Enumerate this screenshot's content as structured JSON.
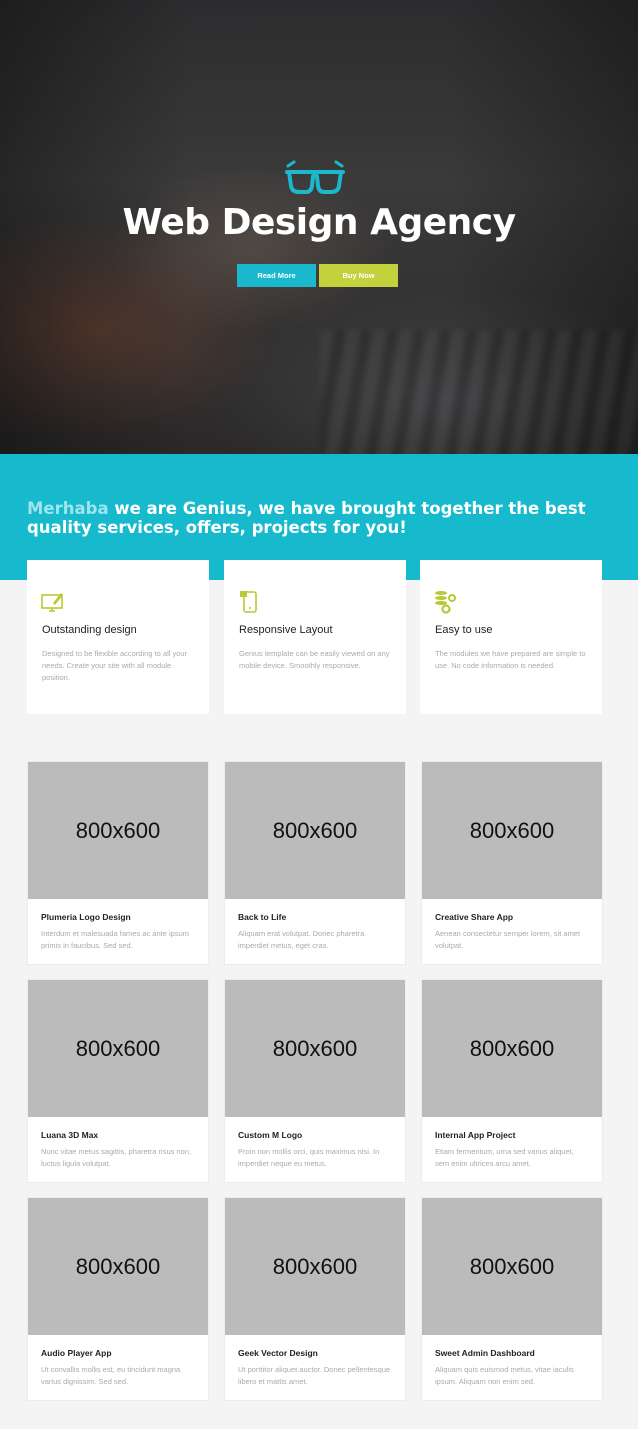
{
  "hero": {
    "icon": "glasses-icon",
    "title": "Web Design Agency",
    "read_more": "Read More",
    "buy_now": "Buy Now"
  },
  "intro": {
    "highlight": "Merhaba",
    "text": " we are Genius, we have brought together the best quality services, offers, projects for you!"
  },
  "features": [
    {
      "icon": "monitor-pen-icon",
      "title": "Outstanding design",
      "desc": "Designed to be flexible according to all your needs. Create your site with all module position."
    },
    {
      "icon": "mobile-icon",
      "title": "Responsive Layout",
      "desc": "Genius template can be easily viewed on any mobile device. Smoothly responsive."
    },
    {
      "icon": "database-gear-icon",
      "title": "Easy to use",
      "desc": "The modules we have prepared are simple to use. No code information is needed."
    }
  ],
  "portfolio": [
    {
      "image": "800x600",
      "title": "Plumeria Logo Design",
      "desc": "Interdum et malesuada fames ac ante ipsum primis in faucibus. Sed sed."
    },
    {
      "image": "800x600",
      "title": "Back to Life",
      "desc": "Aliquam erat volutpat. Donec pharetra imperdiet metus, eget cras."
    },
    {
      "image": "800x600",
      "title": "Creative Share App",
      "desc": "Aenean consectetur semper lorem, sit amet volutpat."
    },
    {
      "image": "800x600",
      "title": "Luana 3D Max",
      "desc": "Nunc vitae metus sagittis, pharetra risus non, luctus ligula volutpat."
    },
    {
      "image": "800x600",
      "title": "Custom M Logo",
      "desc": "Proin non mollis orci, quis maximus nisi. In imperdiet neque eu metus."
    },
    {
      "image": "800x600",
      "title": "Internal App Project",
      "desc": "Etiam fermentum, urna sed varius aliquet, sem enim ultrices arcu amet."
    },
    {
      "image": "800x600",
      "title": "Audio Player App",
      "desc": "Ut convallis mollis est, eu tincidunt magna varius dignissim. Sed sed."
    },
    {
      "image": "800x600",
      "title": "Geek Vector Design",
      "desc": "Ut porttitor aliquet auctor. Donec pellentesque libero et mattis amet."
    },
    {
      "image": "800x600",
      "title": "Sweet Admin Dashboard",
      "desc": "Aliquam quis euismod metus, vitae iaculis ipsum. Aliquam non enim sed."
    }
  ],
  "colors": {
    "accent": "#17bacd",
    "secondary": "#c3d13c"
  }
}
